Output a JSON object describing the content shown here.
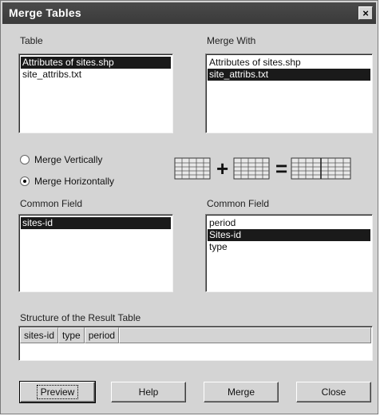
{
  "window": {
    "title": "Merge Tables",
    "close_glyph": "×"
  },
  "table_list": {
    "label": "Table",
    "items": [
      "Attributes of sites.shp",
      "site_attribs.txt"
    ],
    "selected_index": 0
  },
  "merge_with_list": {
    "label": "Merge With",
    "items": [
      "Attributes of sites.shp",
      "site_attribs.txt"
    ],
    "selected_index": 1
  },
  "merge_mode": {
    "vertical_label": "Merge Vertically",
    "horizontal_label": "Merge Horizontally",
    "selected": "horizontal"
  },
  "diagram": {
    "plus": "+",
    "equals": "="
  },
  "common_field_left": {
    "label": "Common Field",
    "items": [
      "sites-id"
    ],
    "selected_index": 0
  },
  "common_field_right": {
    "label": "Common Field",
    "items": [
      "period",
      "Sites-id",
      "type"
    ],
    "selected_index": 1
  },
  "result_table": {
    "label": "Structure of the Result Table",
    "columns": [
      "sites-id",
      "type",
      "period"
    ]
  },
  "buttons": {
    "preview": "Preview",
    "help": "Help",
    "merge": "Merge",
    "close": "Close"
  },
  "colors": {
    "selection": "#1a1a1a",
    "dialog_bg": "#d4d4d4",
    "titlebar": "#404040"
  }
}
